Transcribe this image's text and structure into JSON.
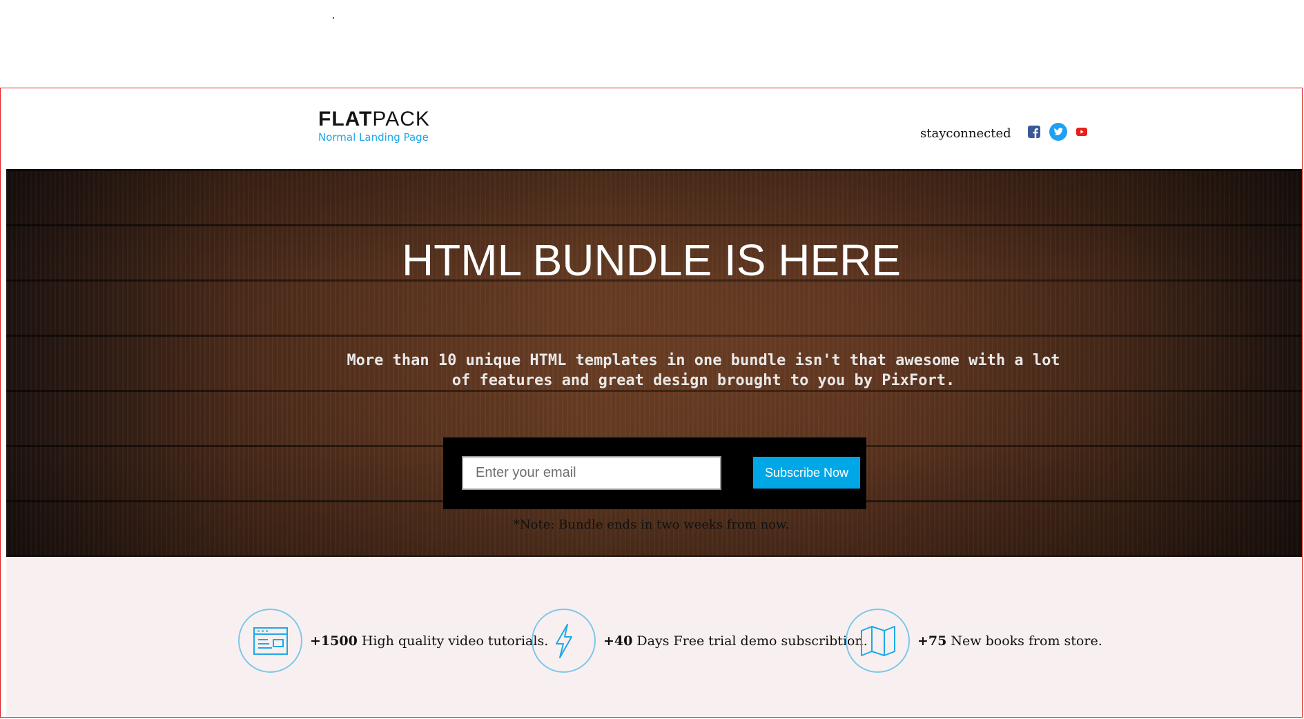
{
  "header": {
    "logo_bold": "FLAT",
    "logo_light": "PACK",
    "logo_subtitle": "Normal Landing Page",
    "social_label": "stayconnected",
    "social_icons": [
      "facebook-icon",
      "twitter-icon",
      "youtube-icon"
    ]
  },
  "hero": {
    "title": "HTML BUNDLE IS HERE",
    "description": "More than 10 unique HTML templates in one bundle isn't that awesome with a lot of features and great design brought to you by PixFort.",
    "email_placeholder": "Enter your email",
    "subscribe_label": "Subscribe Now",
    "note": "*Note: Bundle ends in two weeks from now."
  },
  "features": [
    {
      "icon": "browser-window-icon",
      "number": "+1500",
      "text": "High quality video tutorials."
    },
    {
      "icon": "lightning-bolt-icon",
      "number": "+40",
      "text": "Days Free trial demo subscribtion."
    },
    {
      "icon": "map-icon",
      "number": "+75",
      "text": "New books from store."
    }
  ],
  "colors": {
    "accent": "#00a7e7",
    "frame_border": "#e02020",
    "features_bg": "#f8f0f0",
    "facebook": "#3b5998",
    "twitter": "#1da1f2",
    "youtube": "#e62117"
  }
}
